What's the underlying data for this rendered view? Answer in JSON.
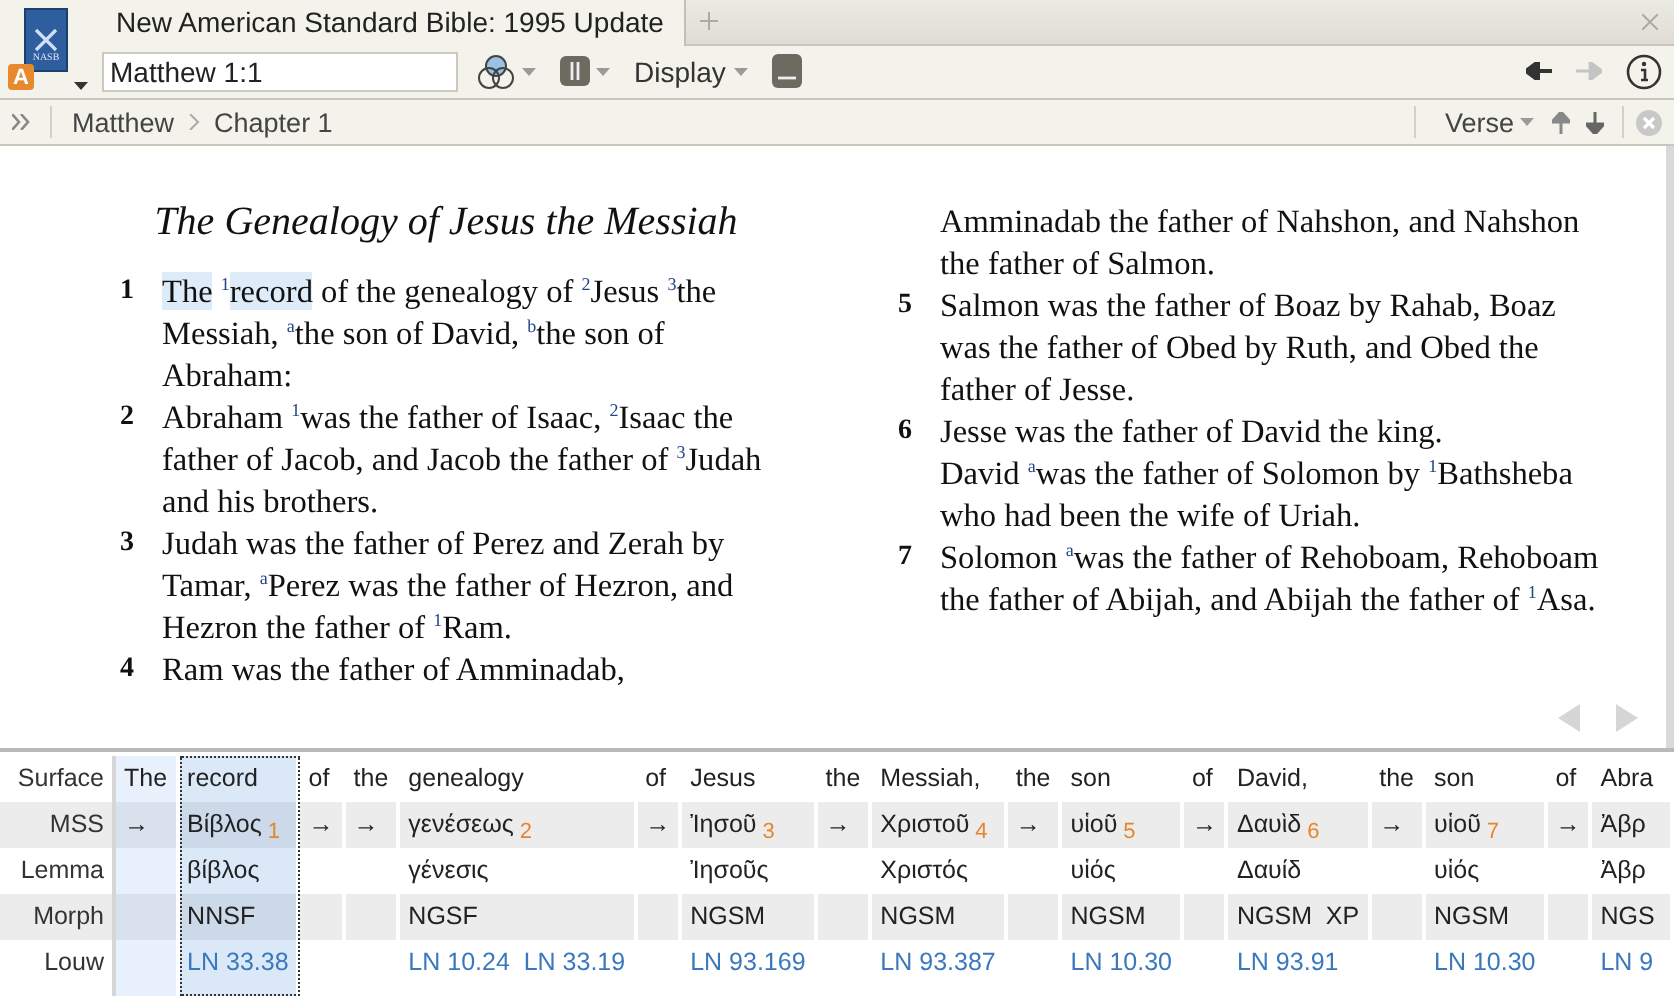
{
  "logo": {
    "cover_text": "NASB",
    "badge": "A"
  },
  "tabs": [
    {
      "label": "New American Standard Bible: 1995 Update",
      "selected": true
    }
  ],
  "toolbar": {
    "reference": "Matthew 1:1",
    "display_menu": "Display",
    "back_disabled": false,
    "forward_disabled": true
  },
  "breadcrumb": [
    "Matthew",
    "Chapter 1"
  ],
  "nav_mode": "Verse",
  "passage": {
    "heading": "The Genealogy of Jesus the Messiah",
    "columns": [
      [
        {
          "number": "1",
          "segments": [
            {
              "text": "The",
              "highlighted": true
            },
            {
              "text": " $^{1}$",
              "highlighted": false
            },
            {
              "text": "record",
              "highlighted": true
            },
            {
              "text": " of the genealogy of $^{2}$Jesus $^{3}$the Messiah, $^{a}$the son of David, $^{b}$the son of Abraham:",
              "highlighted": false
            }
          ]
        },
        {
          "number": "2",
          "segments": [
            {
              "text": "Abraham $^{1}$was the father of Isaac, $^{2}$Isaac the father of Jacob, and Jacob the father of $^{3}$Judah and his brothers.",
              "highlighted": false
            }
          ]
        },
        {
          "number": "3",
          "segments": [
            {
              "text": "Judah was the father of Perez and Zerah by Tamar, $^{a}$Perez was the father of Hezron, and Hezron the father of $^{1}$Ram.",
              "highlighted": false
            }
          ]
        },
        {
          "number": "4",
          "segments": [
            {
              "text": "Ram was the father of Amminadab,",
              "highlighted": false
            }
          ]
        }
      ],
      [
        {
          "segments": [
            {
              "text": "Amminadab the father of Nahshon, and Nahshon the father of Salmon.",
              "highlighted": false
            }
          ]
        },
        {
          "number": "5",
          "segments": [
            {
              "text": "Salmon was the father of Boaz by Rahab, Boaz was the father of Obed by Ruth, and Obed the father of Jesse.",
              "highlighted": false
            }
          ]
        },
        {
          "number": "6",
          "segments": [
            {
              "text": "Jesse was the father of David the king.",
              "highlighted": false
            }
          ]
        },
        {
          "segments": [
            {
              "text": "David $^{a}$was the father of Solomon by $^{1}$Bathsheba who had been the wife of Uriah.",
              "highlighted": false
            }
          ]
        },
        {
          "number": "7",
          "segments": [
            {
              "text": "Solomon $^{a}$was the father of Rehoboam, Rehoboam the father of Abijah, and Abijah the father of $^{1}$Asa.",
              "highlighted": false
            }
          ]
        }
      ]
    ]
  },
  "interlinear": {
    "row_labels": [
      "Surface",
      "MSS",
      "Lemma",
      "Morph",
      "Louw"
    ],
    "words": [
      {
        "surface": "The",
        "mss": "→",
        "highlighted": true,
        "selected": false
      },
      {
        "surface": "record",
        "mss": "Βίβλος",
        "mss_index": "1",
        "lemma": "βίβλος",
        "morph": "NNSF",
        "louw": "LN 33.38",
        "highlighted": true,
        "selected": true
      },
      {
        "surface": "of",
        "mss": "→",
        "highlighted": false,
        "selected": false
      },
      {
        "surface": "the",
        "mss": "→",
        "highlighted": false,
        "selected": false
      },
      {
        "surface": "genealogy",
        "mss": "γενέσεως",
        "mss_index": "2",
        "lemma": "γένεσις",
        "morph": "NGSF",
        "louw": "LN 10.24  LN 33.19",
        "highlighted": false,
        "selected": false
      },
      {
        "surface": "of",
        "mss": "→",
        "highlighted": false,
        "selected": false
      },
      {
        "surface": "Jesus",
        "mss": "Ἰησοῦ",
        "mss_index": "3",
        "lemma": "Ἰησοῦς",
        "morph": "NGSM",
        "louw": "LN 93.169",
        "highlighted": false,
        "selected": false
      },
      {
        "surface": "the",
        "mss": "→",
        "highlighted": false,
        "selected": false
      },
      {
        "surface": "Messiah,",
        "mss": "Χριστοῦ",
        "mss_index": "4",
        "lemma": "Χριστός",
        "morph": "NGSM",
        "louw": "LN 93.387",
        "highlighted": false,
        "selected": false
      },
      {
        "surface": "the",
        "mss": "→",
        "highlighted": false,
        "selected": false
      },
      {
        "surface": "son",
        "mss": "υἱοῦ",
        "mss_index": "5",
        "lemma": "υἱός",
        "morph": "NGSM",
        "louw": "LN 10.30",
        "highlighted": false,
        "selected": false
      },
      {
        "surface": "of",
        "mss": "→",
        "highlighted": false,
        "selected": false
      },
      {
        "surface": "David,",
        "mss": "Δαυὶδ",
        "mss_index": "6",
        "lemma": "Δαυίδ",
        "morph": "NGSM  XP",
        "louw": "LN 93.91",
        "highlighted": false,
        "selected": false
      },
      {
        "surface": "the",
        "mss": "→",
        "highlighted": false,
        "selected": false
      },
      {
        "surface": "son",
        "mss": "υἱοῦ",
        "mss_index": "7",
        "lemma": "υἱός",
        "morph": "NGSM",
        "louw": "LN 10.30",
        "highlighted": false,
        "selected": false
      },
      {
        "surface": "of",
        "mss": "→",
        "highlighted": false,
        "selected": false
      },
      {
        "surface": "Abra",
        "mss": "Ἀβρ",
        "lemma": "Ἀβρ",
        "morph": "NGS",
        "louw": "LN 9",
        "highlighted": false,
        "selected": false
      }
    ]
  }
}
